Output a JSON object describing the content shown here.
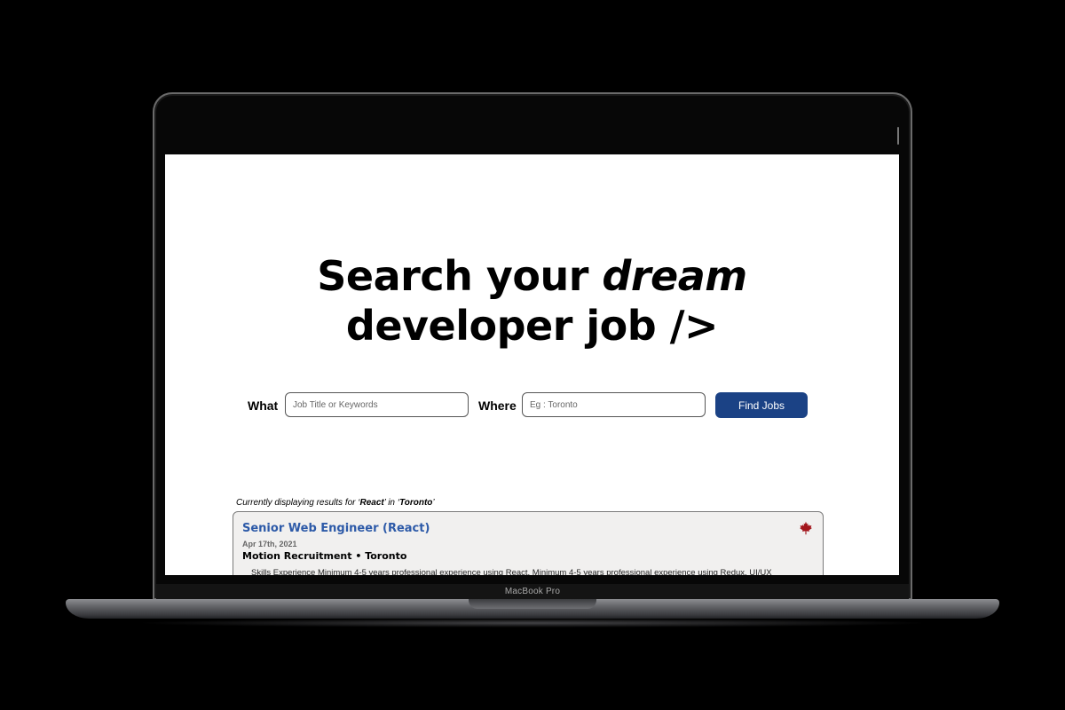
{
  "device": {
    "model_label": "MacBook Pro"
  },
  "hero": {
    "line1_prefix": "Search your",
    "line1_emphasis": "dream",
    "line2": "developer job />"
  },
  "search": {
    "what_label": "What",
    "what_placeholder": "Job Title or Keywords",
    "where_label": "Where",
    "where_placeholder": "Eg : Toronto",
    "button_label": "Find Jobs"
  },
  "results": {
    "status_prefix": "Currently displaying results for ‘",
    "status_query": "React",
    "status_mid": "’ in ‘",
    "status_location": "Toronto",
    "status_suffix": "’",
    "jobs": [
      {
        "title": "Senior Web Engineer (React)",
        "date": "Apr 17th, 2021",
        "company_location": "Motion Recruitment • Toronto",
        "description": "Skills Experience Minimum 4-5 years professional experience using React. Minimum 4-5 years professional experience using Redux. UI/UX",
        "country_icon": "maple-leaf-icon"
      }
    ]
  },
  "colors": {
    "accent": "#1b4285",
    "job_title": "#2d5aa8",
    "card_bg": "#f1f0ef",
    "maple": "#a3161c"
  }
}
